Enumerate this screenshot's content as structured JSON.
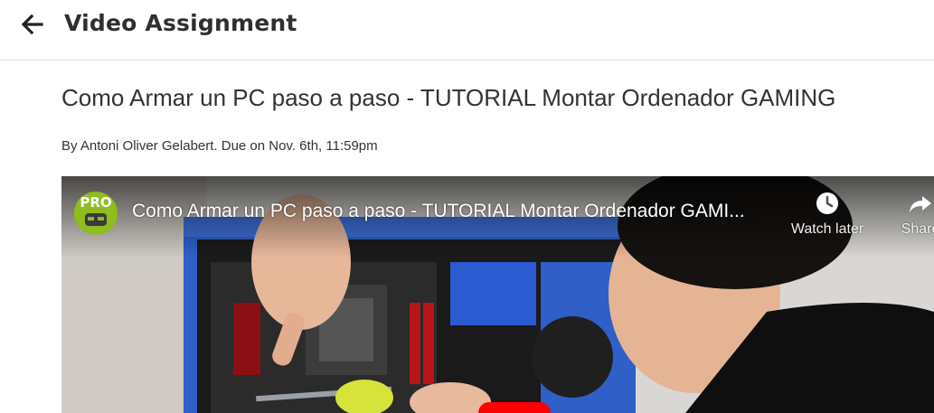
{
  "header": {
    "title": "Video Assignment",
    "back_icon": "arrow-left-icon"
  },
  "assignment": {
    "video_title": "Como Armar un PC paso a paso - TUTORIAL Montar Ordenador GAMING",
    "byline": "By Antoni Oliver Gelabert. Due on Nov. 6th, 11:59pm"
  },
  "player": {
    "channel_badge": "PRO",
    "title": "Como Armar un PC paso a paso - TUTORIAL Montar Ordenador GAMI...",
    "watch_later_label": "Watch later",
    "share_label": "Share",
    "watch_later_icon": "clock-icon",
    "share_icon": "share-arrow-icon",
    "play_button_color": "#ff0000",
    "case_color": "#2f5fc7"
  }
}
